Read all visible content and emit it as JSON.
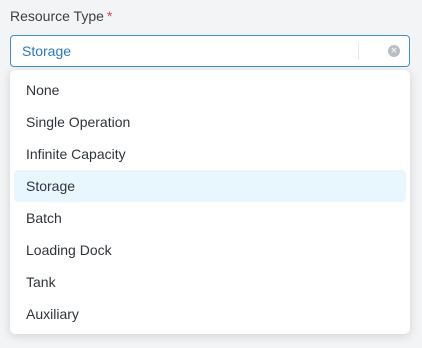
{
  "field": {
    "label": "Resource Type",
    "required_marker": "*"
  },
  "select": {
    "value": "Storage",
    "clear_icon": "clear-circle-icon"
  },
  "dropdown": {
    "selected": "Storage",
    "options": [
      "None",
      "Single Operation",
      "Infinite Capacity",
      "Storage",
      "Batch",
      "Loading Dock",
      "Tank",
      "Auxiliary"
    ]
  },
  "colors": {
    "focus_border": "#3f8fd1",
    "selected_text": "#2c78c2",
    "selected_option_bg": "#e8f7fd",
    "required": "#e5484d"
  }
}
